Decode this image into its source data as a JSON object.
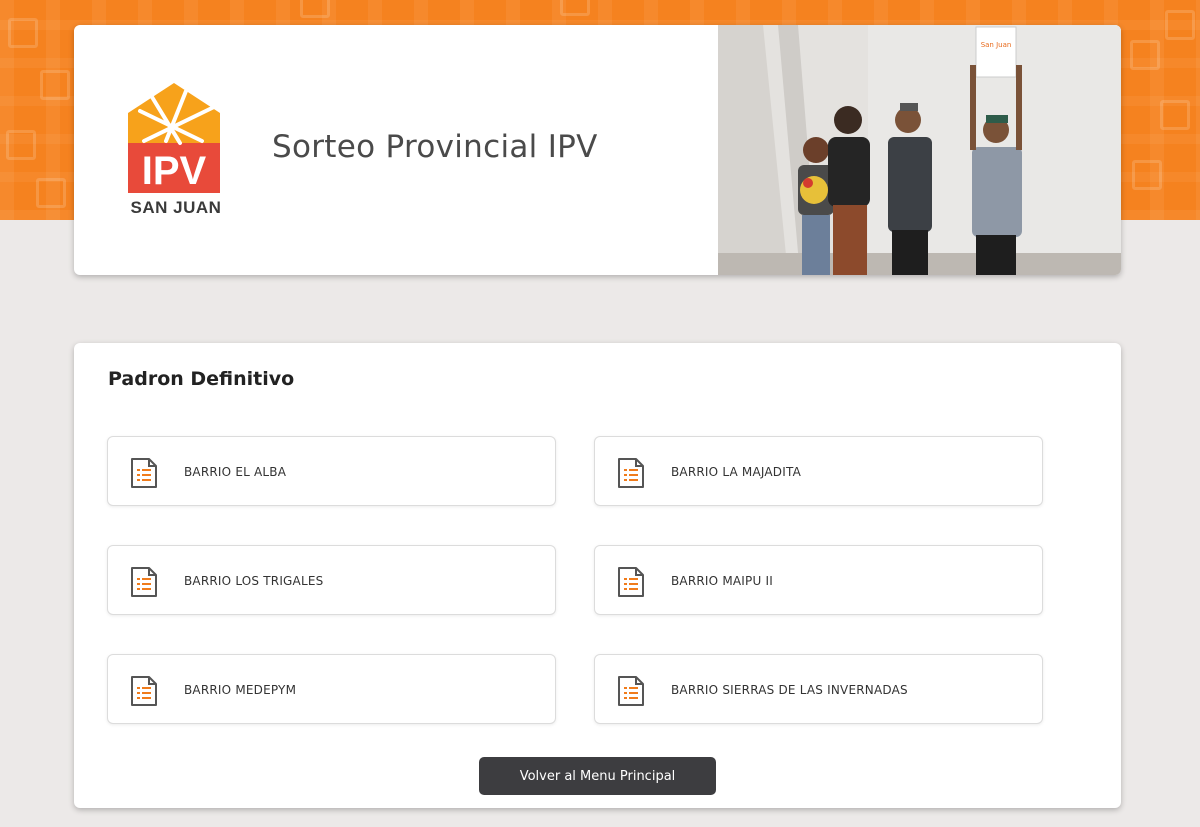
{
  "header": {
    "title": "Sorteo Provincial IPV",
    "logo": {
      "letters": "IPV",
      "subtitle": "SAN JUAN"
    },
    "photo_sign": "San Juan"
  },
  "section": {
    "title": "Padron Definitivo",
    "items": [
      {
        "label": "BARRIO EL ALBA",
        "icon": "document-list-icon"
      },
      {
        "label": "BARRIO LA MAJADITA",
        "icon": "document-list-icon"
      },
      {
        "label": "BARRIO LOS TRIGALES",
        "icon": "document-list-icon"
      },
      {
        "label": "BARRIO MAIPU II",
        "icon": "document-list-icon"
      },
      {
        "label": "BARRIO MEDEPYM",
        "icon": "document-list-icon"
      },
      {
        "label": "BARRIO SIERRAS DE LAS INVERNADAS",
        "icon": "document-list-icon"
      }
    ]
  },
  "actions": {
    "back_label": "Volver al Menu Principal"
  },
  "colors": {
    "brand_orange": "#f5821f",
    "logo_red": "#e84a3a",
    "button_dark": "#3d3d40",
    "page_bg": "#ece9e8"
  }
}
